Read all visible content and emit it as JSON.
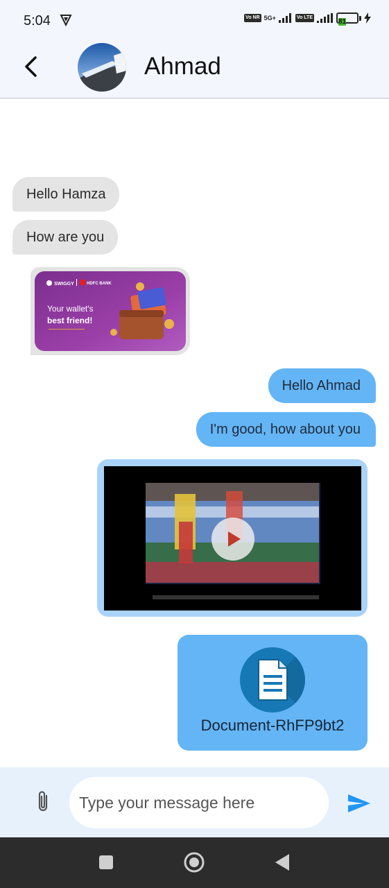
{
  "status_bar": {
    "time": "5:04",
    "network_label": "5G+",
    "volte_label_1": "Vo NR",
    "volte_label_2": "Vo LTE",
    "battery_level": "81"
  },
  "header": {
    "contact_name": "Ahmad"
  },
  "messages": [
    {
      "direction": "incoming",
      "type": "text",
      "text": "Hello Hamza"
    },
    {
      "direction": "incoming",
      "type": "text",
      "text": "How are you"
    },
    {
      "direction": "incoming",
      "type": "image"
    },
    {
      "direction": "outgoing",
      "type": "text",
      "text": "Hello Ahmad"
    },
    {
      "direction": "outgoing",
      "type": "text",
      "text": "I'm good, how about you"
    },
    {
      "direction": "outgoing",
      "type": "video"
    },
    {
      "direction": "outgoing",
      "type": "document",
      "file_name": "Document-RhFP9bt2"
    }
  ],
  "promo_image": {
    "brand_1": "SWIGGY",
    "brand_2": "HDFC BANK",
    "headline_line_1": "Your wallet's",
    "headline_line_2": "best friend!"
  },
  "composer": {
    "placeholder": "Type your message here",
    "value": ""
  },
  "colors": {
    "outgoing_bubble": "#64b5f6",
    "incoming_bubble": "#e4e4e4",
    "header_bg": "#f3f7fd",
    "composer_bg": "#e6f1fc",
    "send_icon": "#2196f3",
    "nav_bar": "#2c2c2c"
  },
  "icons": {
    "back": "chevron-left-icon",
    "attach": "paperclip-icon",
    "send": "send-icon",
    "document": "document-icon",
    "play": "play-icon",
    "nav_recents": "square-icon",
    "nav_home": "circle-icon",
    "nav_back": "triangle-left-icon"
  }
}
